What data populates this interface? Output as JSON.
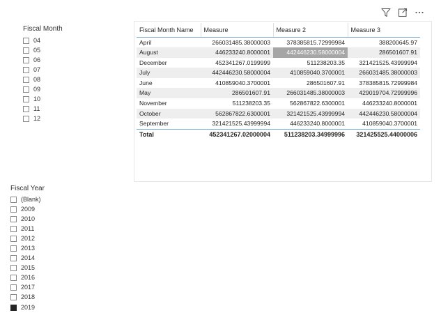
{
  "fiscal_month_slicer": {
    "title": "Fiscal Month",
    "items": [
      {
        "label": "04",
        "checked": false
      },
      {
        "label": "05",
        "checked": false
      },
      {
        "label": "06",
        "checked": false
      },
      {
        "label": "07",
        "checked": false
      },
      {
        "label": "08",
        "checked": false
      },
      {
        "label": "09",
        "checked": false
      },
      {
        "label": "10",
        "checked": false
      },
      {
        "label": "11",
        "checked": false
      },
      {
        "label": "12",
        "checked": false
      }
    ]
  },
  "fiscal_year_slicer": {
    "title": "Fiscal Year",
    "items": [
      {
        "label": "(Blank)",
        "checked": false
      },
      {
        "label": "2009",
        "checked": false
      },
      {
        "label": "2010",
        "checked": false
      },
      {
        "label": "2011",
        "checked": false
      },
      {
        "label": "2012",
        "checked": false
      },
      {
        "label": "2013",
        "checked": false
      },
      {
        "label": "2014",
        "checked": false
      },
      {
        "label": "2015",
        "checked": false
      },
      {
        "label": "2016",
        "checked": false
      },
      {
        "label": "2017",
        "checked": false
      },
      {
        "label": "2018",
        "checked": false
      },
      {
        "label": "2019",
        "checked": true
      }
    ]
  },
  "visual_header": {
    "icons": [
      "filter-icon",
      "focus-mode-icon",
      "more-options-icon"
    ]
  },
  "table": {
    "columns": [
      "Fiscal Month Name",
      "Measure",
      "Measure 2",
      "Measure 3"
    ],
    "rows": [
      [
        "April",
        "266031485.38000003",
        "378385815.72999984",
        "388200645.97"
      ],
      [
        "August",
        "446233240.8000001",
        "442446230.58000004",
        "286501607.91"
      ],
      [
        "December",
        "452341267.0199999",
        "511238203.35",
        "321421525.43999994"
      ],
      [
        "July",
        "442446230.58000004",
        "410859040.3700001",
        "266031485.38000003"
      ],
      [
        "June",
        "410859040.3700001",
        "286501607.91",
        "378385815.72999984"
      ],
      [
        "May",
        "286501607.91",
        "266031485.38000003",
        "429019704.72999996"
      ],
      [
        "November",
        "511238203.35",
        "562867822.6300001",
        "446233240.8000001"
      ],
      [
        "October",
        "562867822.6300001",
        "321421525.43999994",
        "442446230.58000004"
      ],
      [
        "September",
        "321421525.43999994",
        "446233240.8000001",
        "410859040.3700001"
      ]
    ],
    "total": [
      "Total",
      "452341267.02000004",
      "511238203.34999996",
      "321425525.44000006"
    ],
    "selected_cell": {
      "row": 1,
      "col": 2
    },
    "colors": {
      "header_border": "#7fb3d5",
      "alt_row": "#eeeeee",
      "selected": "#a6a6a6"
    }
  }
}
